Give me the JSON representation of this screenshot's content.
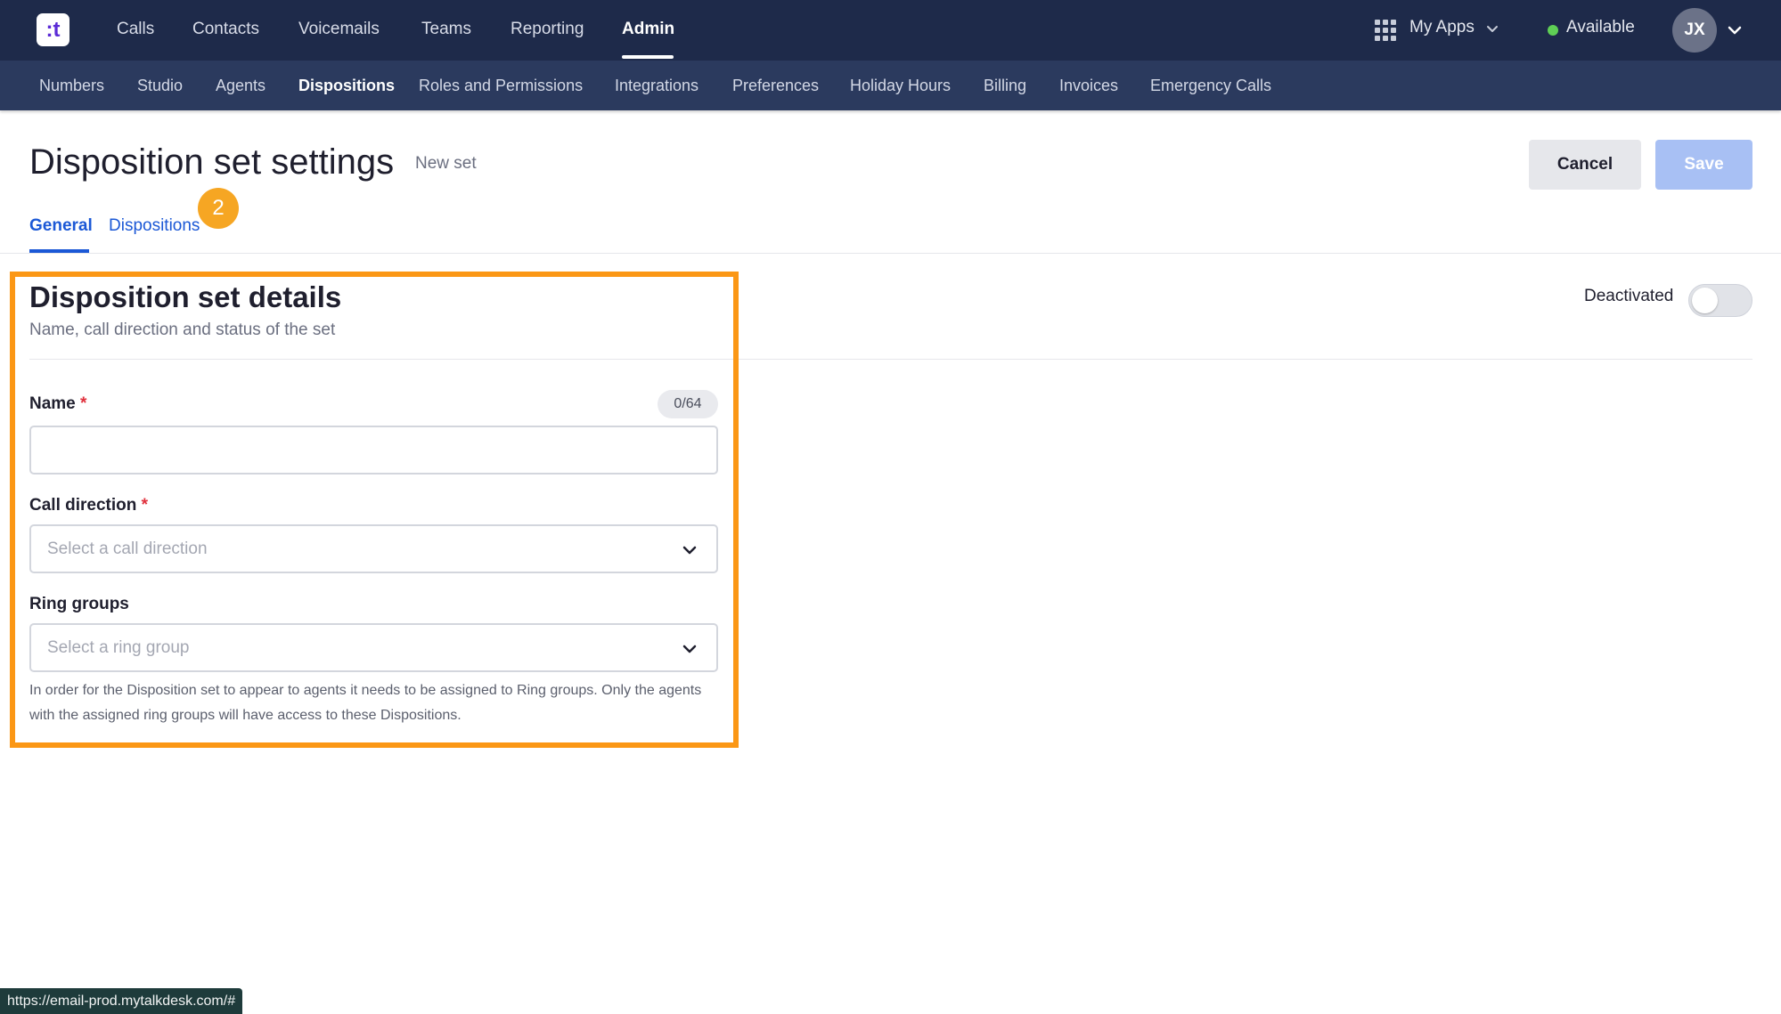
{
  "app": {
    "logo_text": ":t",
    "brand_color": "#5b2bd6",
    "accent_color": "#1b58d6"
  },
  "topnav": {
    "items": [
      {
        "label": "Calls"
      },
      {
        "label": "Contacts"
      },
      {
        "label": "Voicemails"
      },
      {
        "label": "Teams"
      },
      {
        "label": "Reporting"
      },
      {
        "label": "Admin",
        "active": true
      }
    ],
    "my_apps": "My Apps",
    "status": "Available",
    "status_color": "#5fcf55",
    "avatar_initials": "JX"
  },
  "subnav": {
    "items": [
      {
        "label": "Numbers"
      },
      {
        "label": "Studio"
      },
      {
        "label": "Agents"
      },
      {
        "label": "Dispositions",
        "active": true
      },
      {
        "label": "Roles and Permissions"
      },
      {
        "label": "Integrations"
      },
      {
        "label": "Preferences"
      },
      {
        "label": "Holiday Hours"
      },
      {
        "label": "Billing"
      },
      {
        "label": "Invoices"
      },
      {
        "label": "Emergency Calls"
      }
    ]
  },
  "header": {
    "title": "Disposition set settings",
    "subtitle": "New set",
    "cancel_label": "Cancel",
    "save_label": "Save"
  },
  "tabs": [
    {
      "label": "General",
      "active": true
    },
    {
      "label": "Dispositions"
    }
  ],
  "step_badge": "2",
  "section": {
    "title": "Disposition set details",
    "subtitle": "Name, call direction and status of the set",
    "toggle_label": "Deactivated",
    "toggle_on": false
  },
  "form": {
    "name": {
      "label": "Name",
      "required_mark": "*",
      "counter": "0/64",
      "value": ""
    },
    "call_direction": {
      "label": "Call direction",
      "required_mark": "*",
      "placeholder": "Select a call direction"
    },
    "ring_groups": {
      "label": "Ring groups",
      "placeholder": "Select a ring group",
      "helper": "In order for the Disposition set to appear to agents it needs to be assigned to Ring groups. Only the agents with the assigned ring groups will have access to these Dispositions."
    }
  },
  "status_bar": {
    "url": "https://email-prod.mytalkdesk.com/#"
  }
}
